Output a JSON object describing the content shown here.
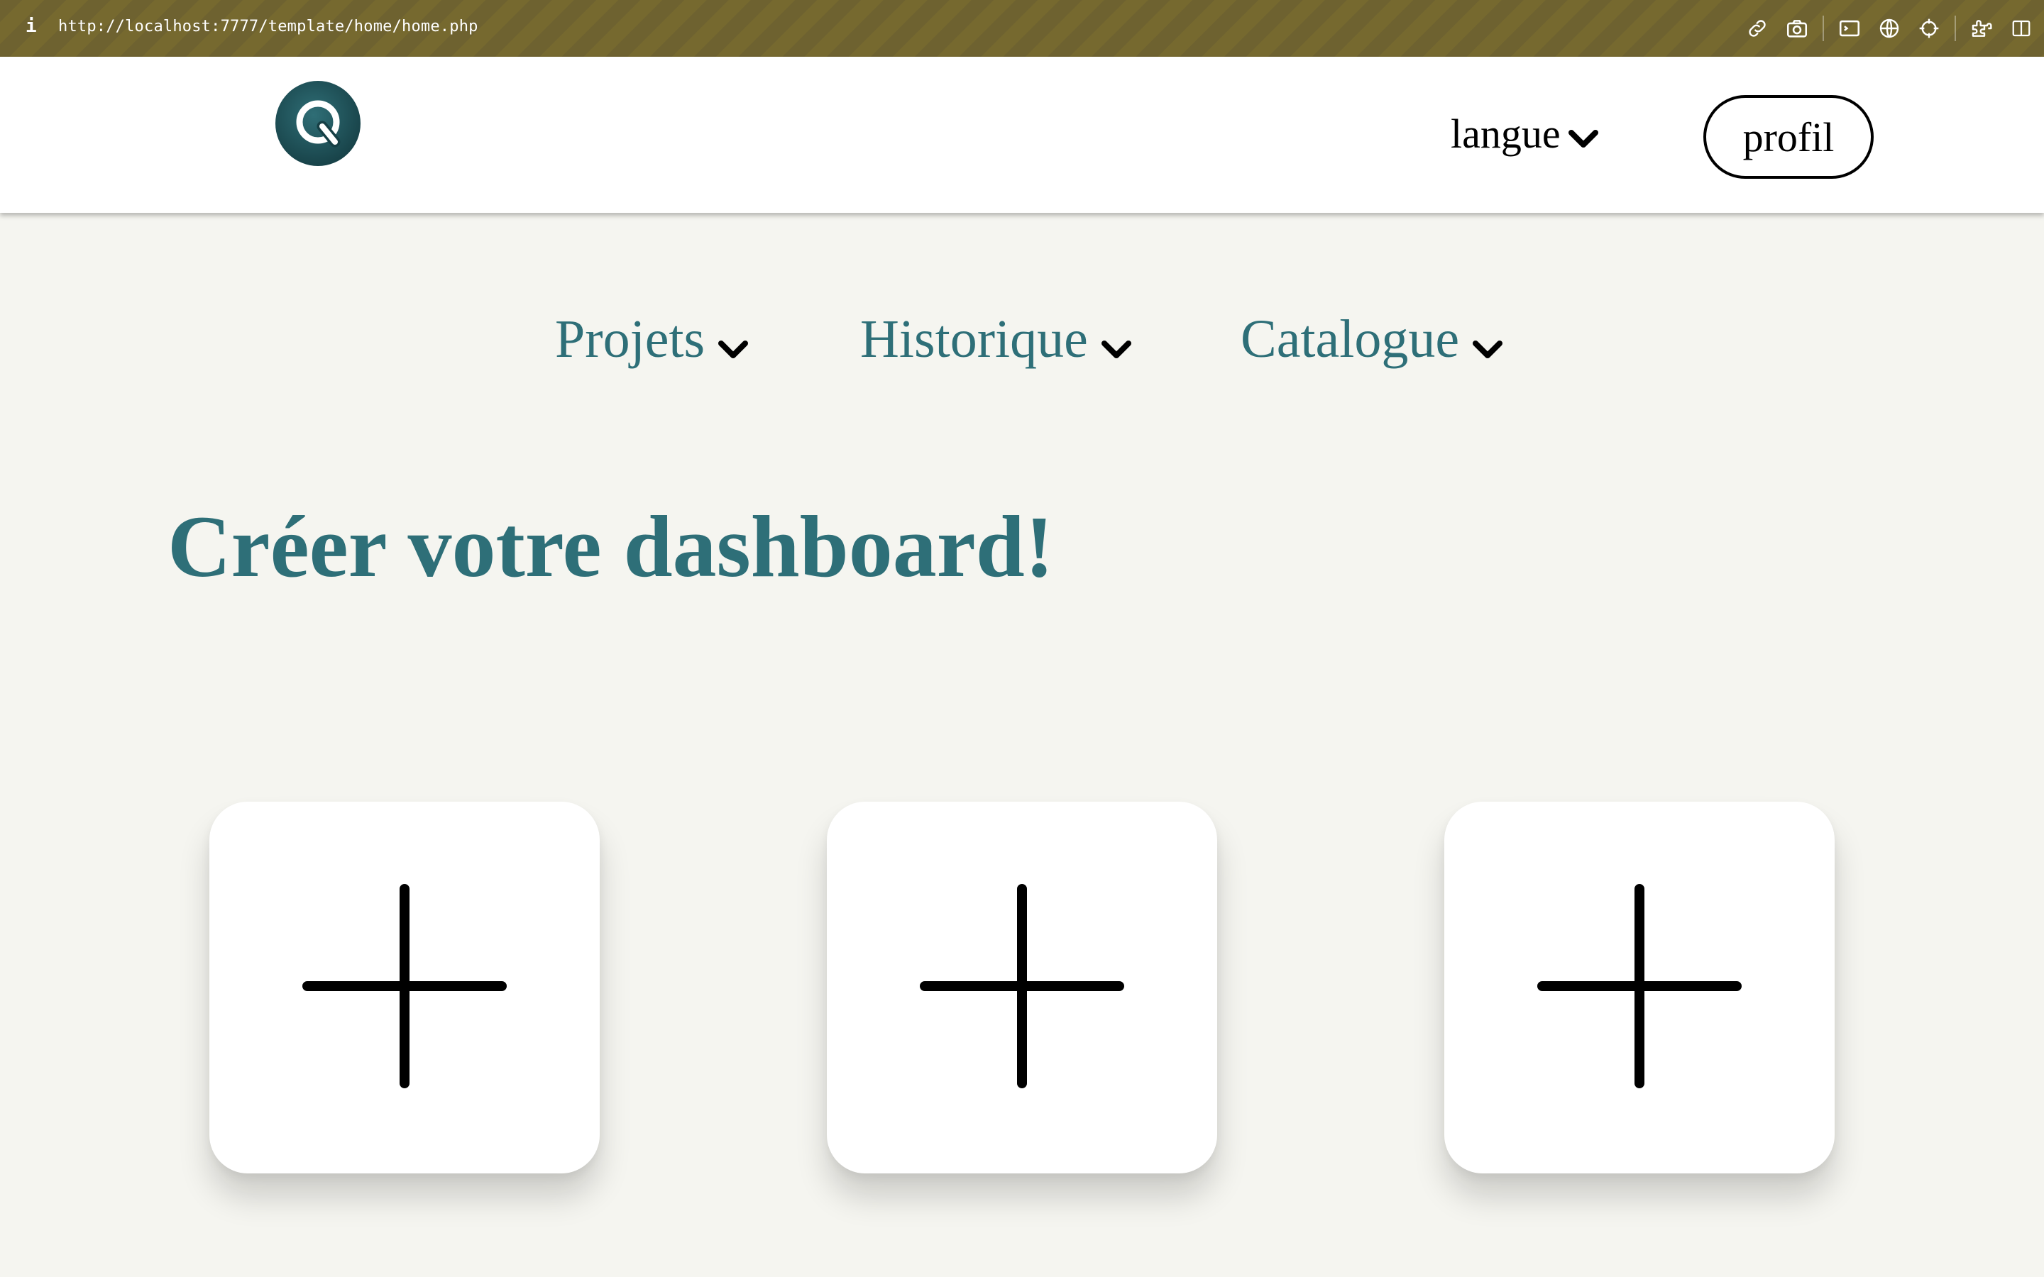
{
  "browser": {
    "info_glyph": "i",
    "url": "http://localhost:7777/template/home/home.php",
    "tool_icons": [
      "link-icon",
      "camera-icon",
      "terminal-icon",
      "globe-icon",
      "crosshair-icon",
      "extensions-icon",
      "sidebar-icon"
    ]
  },
  "header": {
    "logo_letter": "Q",
    "language_label": "langue",
    "profile_label": "profil"
  },
  "nav": {
    "items": [
      {
        "label": "Projets"
      },
      {
        "label": "Historique"
      },
      {
        "label": "Catalogue"
      }
    ]
  },
  "main": {
    "title": "Créer votre dashboard!",
    "cards": [
      {
        "icon": "plus-icon"
      },
      {
        "icon": "plus-icon"
      },
      {
        "icon": "plus-icon"
      }
    ]
  },
  "colors": {
    "accent": "#2e6f78",
    "logo": "#1f4f56",
    "background": "#f5f5f0",
    "urlbar": "#6e6230"
  }
}
